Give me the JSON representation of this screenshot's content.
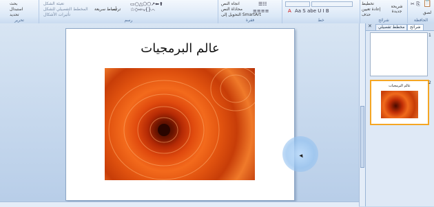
{
  "ribbon": {
    "groups": {
      "drawing": {
        "label": "رسم",
        "shape_fill": "تعبئة الشكل",
        "shape_outline": "المخطط التفصيلي للشكل",
        "shape_effects": "تأثيرات الأشكال",
        "arrange": "ترتيب",
        "quick_styles": "أنماط سريعة"
      },
      "paragraph": {
        "label": "فقرة",
        "text_direction": "اتجاه النص",
        "align_text": "محاذاة النص",
        "convert_smartart": "التحويل إلى SmartArt"
      },
      "font": {
        "label": "خط"
      },
      "slides": {
        "label": "شرائح",
        "layout": "تخطيط",
        "reset": "إعادة تعيين",
        "new_slide": "شريحة جديدة",
        "delete": "حذف"
      },
      "clipboard": {
        "label": "الحافظة",
        "paste": "لصق"
      },
      "editing": {
        "label": "تحرير",
        "find": "بحث",
        "replace": "استبدال",
        "select": "تحديد"
      }
    }
  },
  "slide": {
    "title": "عالم البرمجيات"
  },
  "panel": {
    "tabs": {
      "outline": "مخطط تفصيلي",
      "slides": "شرائح"
    },
    "thumbnails": [
      {
        "number": "1"
      },
      {
        "number": "2",
        "title": "عالم البرمجيات"
      }
    ]
  },
  "colors": {
    "accent_orange": "#f5a623",
    "ribbon_border": "#9ab5d6"
  }
}
